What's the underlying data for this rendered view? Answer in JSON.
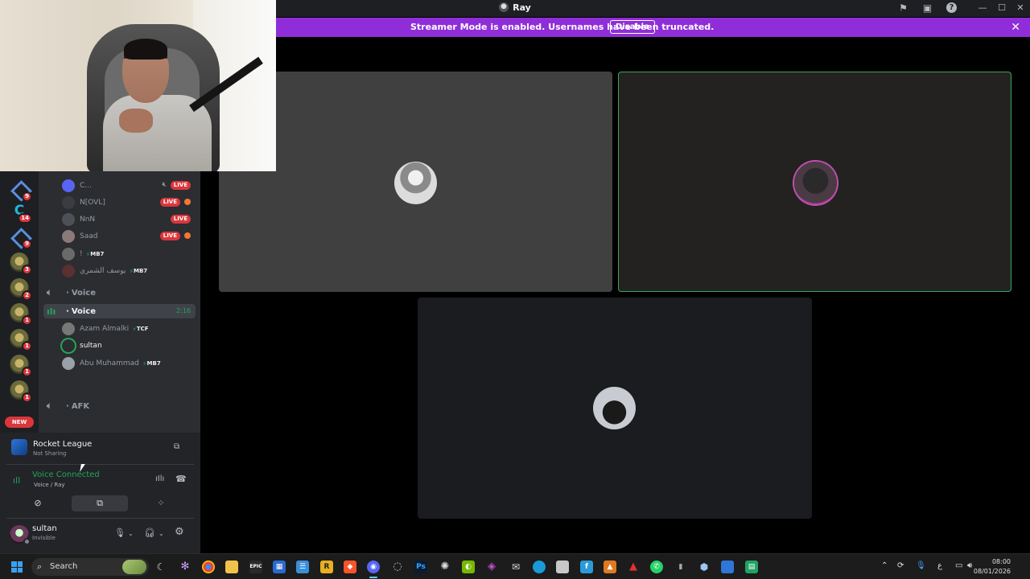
{
  "window": {
    "title": "Ray"
  },
  "banner": {
    "text": "Streamer Mode is enabled. Usernames have been truncated.",
    "button": "Disable"
  },
  "guilds": [
    {
      "type": "diamond",
      "badge": "9"
    },
    {
      "type": "cs",
      "badge": "14",
      "glyph": "C"
    },
    {
      "type": "diamond",
      "badge": "9"
    },
    {
      "type": "server",
      "badge": "3"
    },
    {
      "type": "server",
      "badge": "2"
    },
    {
      "type": "server",
      "badge": "1"
    },
    {
      "type": "server",
      "badge": "1"
    },
    {
      "type": "server",
      "badge": "1"
    },
    {
      "type": "server",
      "badge": "1"
    }
  ],
  "new_badge": "NEW",
  "members_top": [
    {
      "name": "C...",
      "live": "LIVE",
      "muted": true,
      "activity": false,
      "tag": ""
    },
    {
      "name": "N[OVL]",
      "live": "LIVE",
      "muted": false,
      "activity": true,
      "tag": ""
    },
    {
      "name": "NnN",
      "live": "LIVE",
      "muted": false,
      "activity": false,
      "tag": ""
    },
    {
      "name": "Saad",
      "live": "LIVE",
      "muted": false,
      "activity": true,
      "tag": ""
    },
    {
      "name": "!",
      "live": "",
      "muted": false,
      "activity": false,
      "tag": "MB7"
    },
    {
      "name": "يوسف الشمري",
      "live": "",
      "muted": false,
      "activity": false,
      "tag": "MB7"
    }
  ],
  "voice_channels": [
    {
      "name": "Voice",
      "active": false,
      "time": ""
    },
    {
      "name": "Voice",
      "active": true,
      "time": "2:16"
    }
  ],
  "members_voice": [
    {
      "name": "Azam Almalki",
      "tag": "TCF"
    },
    {
      "name": "sultan",
      "tag": ""
    },
    {
      "name": "Abu Muhammad",
      "tag": "MB7"
    }
  ],
  "afk_channel": {
    "name": "AFK"
  },
  "activity_panel": {
    "game": "Rocket League",
    "status": "Not Sharing"
  },
  "voice_panel": {
    "title": "Voice Connected",
    "subtitle": "Voice / Ray"
  },
  "user": {
    "name": "sultan",
    "status": "Invisible"
  },
  "taskbar": {
    "search_placeholder": "Search",
    "time": "08:00",
    "date": "08/01/2026",
    "lang": "ع"
  },
  "colors": {
    "accent": "#8f2ed8",
    "live": "#da373c",
    "connected": "#23a55a"
  }
}
